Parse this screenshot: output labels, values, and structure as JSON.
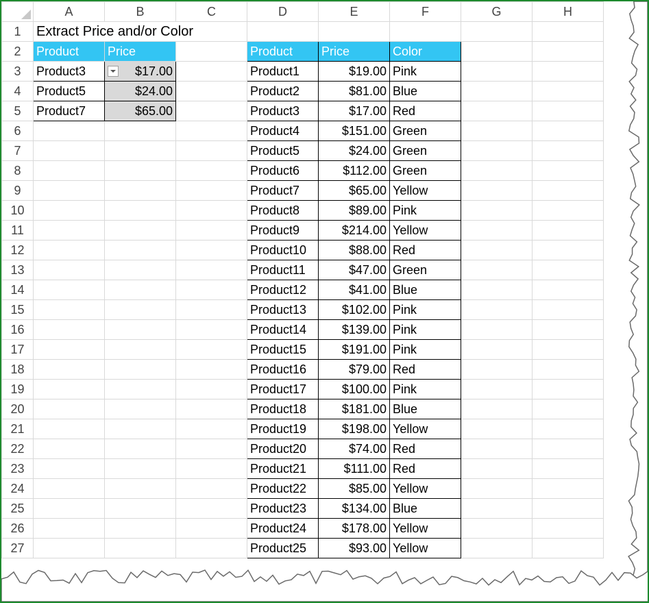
{
  "columns": [
    "A",
    "B",
    "C",
    "D",
    "E",
    "F",
    "G",
    "H"
  ],
  "title": "Extract Price and/or Color",
  "lookup": {
    "headers": [
      "Product",
      "Price"
    ],
    "rows": [
      {
        "product": "Product3",
        "price": "$17.00"
      },
      {
        "product": "Product5",
        "price": "$24.00"
      },
      {
        "product": "Product7",
        "price": "$65.00"
      }
    ]
  },
  "data_table": {
    "headers": [
      "Product",
      "Price",
      "Color"
    ],
    "rows": [
      {
        "product": "Product1",
        "price": "$19.00",
        "color": "Pink"
      },
      {
        "product": "Product2",
        "price": "$81.00",
        "color": "Blue"
      },
      {
        "product": "Product3",
        "price": "$17.00",
        "color": "Red"
      },
      {
        "product": "Product4",
        "price": "$151.00",
        "color": "Green"
      },
      {
        "product": "Product5",
        "price": "$24.00",
        "color": "Green"
      },
      {
        "product": "Product6",
        "price": "$112.00",
        "color": "Green"
      },
      {
        "product": "Product7",
        "price": "$65.00",
        "color": "Yellow"
      },
      {
        "product": "Product8",
        "price": "$89.00",
        "color": "Pink"
      },
      {
        "product": "Product9",
        "price": "$214.00",
        "color": "Yellow"
      },
      {
        "product": "Product10",
        "price": "$88.00",
        "color": "Red"
      },
      {
        "product": "Product11",
        "price": "$47.00",
        "color": "Green"
      },
      {
        "product": "Product12",
        "price": "$41.00",
        "color": "Blue"
      },
      {
        "product": "Product13",
        "price": "$102.00",
        "color": "Pink"
      },
      {
        "product": "Product14",
        "price": "$139.00",
        "color": "Pink"
      },
      {
        "product": "Product15",
        "price": "$191.00",
        "color": "Pink"
      },
      {
        "product": "Product16",
        "price": "$79.00",
        "color": "Red"
      },
      {
        "product": "Product17",
        "price": "$100.00",
        "color": "Pink"
      },
      {
        "product": "Product18",
        "price": "$181.00",
        "color": "Blue"
      },
      {
        "product": "Product19",
        "price": "$198.00",
        "color": "Yellow"
      },
      {
        "product": "Product20",
        "price": "$74.00",
        "color": "Red"
      },
      {
        "product": "Product21",
        "price": "$111.00",
        "color": "Red"
      },
      {
        "product": "Product22",
        "price": "$85.00",
        "color": "Yellow"
      },
      {
        "product": "Product23",
        "price": "$134.00",
        "color": "Blue"
      },
      {
        "product": "Product24",
        "price": "$178.00",
        "color": "Yellow"
      },
      {
        "product": "Product25",
        "price": "$93.00",
        "color": "Yellow"
      }
    ]
  },
  "colors": {
    "header_fill": "#33c5f3",
    "lookup_fill": "#d9d9d9",
    "frame": "#1e8a2e"
  },
  "icons": {
    "dropdown": "dropdown-arrow-icon"
  }
}
